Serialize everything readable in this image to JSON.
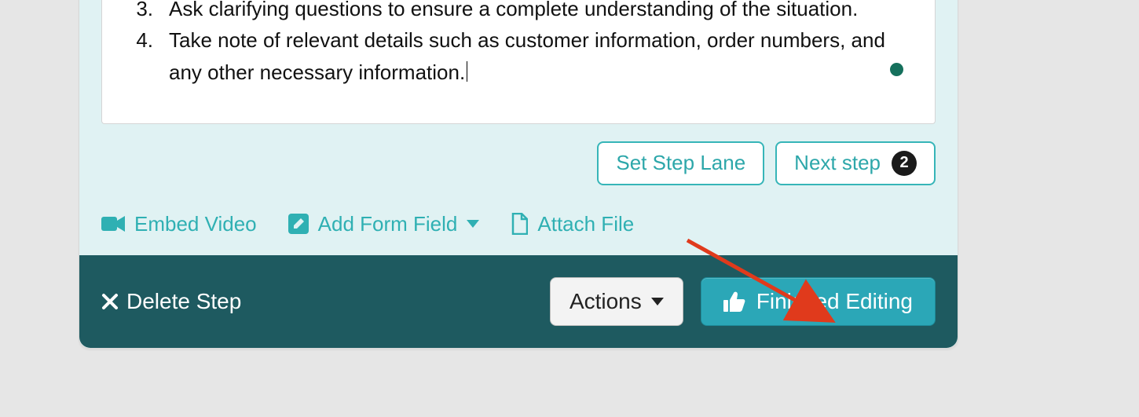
{
  "content": {
    "items": [
      {
        "num": "3.",
        "text": "Ask clarifying questions to ensure a complete understanding of the situation."
      },
      {
        "num": "4.",
        "text": "Take note of relevant details such as customer information, order numbers, and any other necessary information."
      }
    ]
  },
  "lane": {
    "set_step_lane": "Set Step Lane",
    "next_step": "Next step",
    "next_step_count": "2"
  },
  "links": {
    "embed_video": "Embed Video",
    "add_form_field": "Add Form Field",
    "attach_file": "Attach File"
  },
  "footer": {
    "delete_step": "Delete Step",
    "actions": "Actions",
    "finished": "Finished Editing"
  }
}
